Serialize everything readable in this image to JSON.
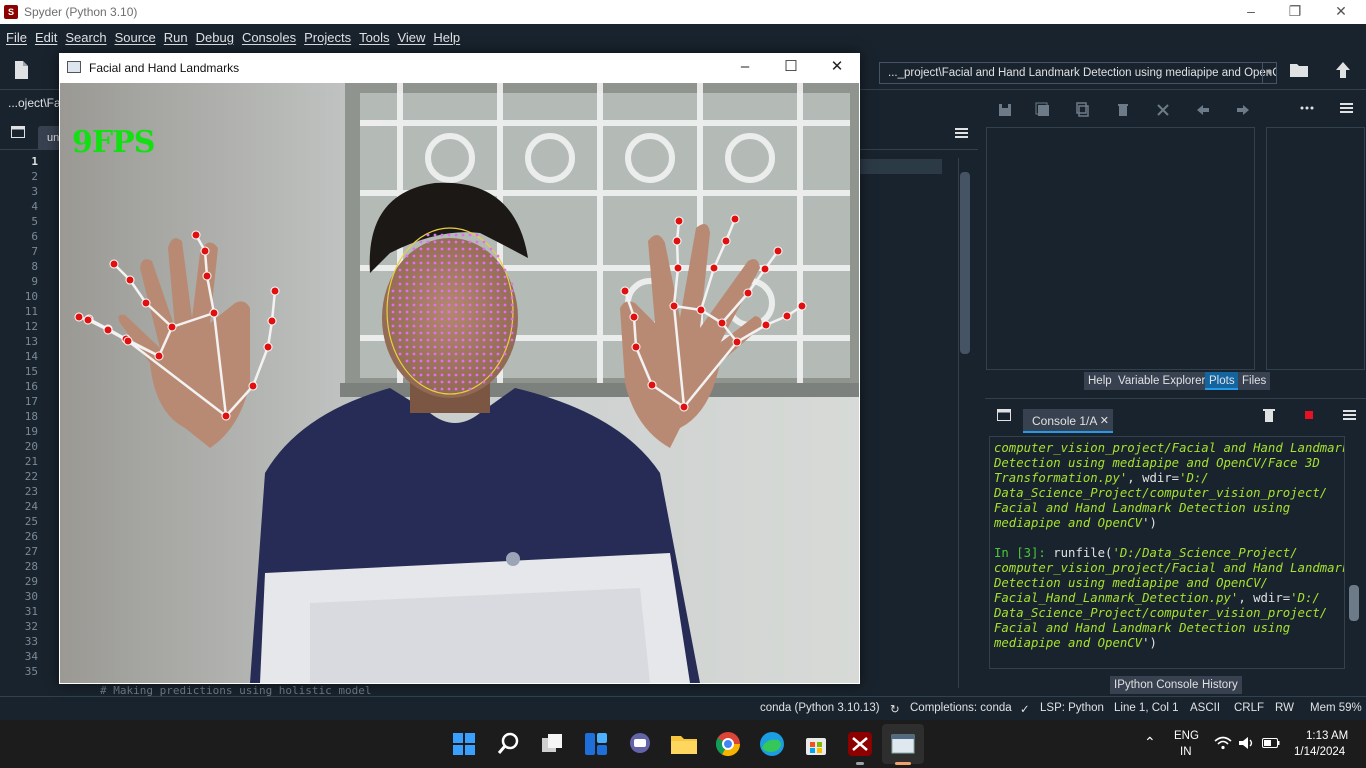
{
  "app": {
    "title": "Spyder (Python 3.10)",
    "icon_name": "spyder-icon",
    "window_controls": [
      "minimize-icon",
      "maximize-icon",
      "close-icon"
    ]
  },
  "menu": [
    "File",
    "Edit",
    "Search",
    "Source",
    "Run",
    "Debug",
    "Consoles",
    "Projects",
    "Tools",
    "View",
    "Help"
  ],
  "toolbar": {
    "path": "..._project\\Facial and Hand Landmark Detection using mediapipe and OpenCV",
    "icons": [
      "new-file-icon",
      "open-file-icon",
      "browse-folder-icon",
      "parent-directory-icon"
    ]
  },
  "editor": {
    "path_label": "...oject\\Fa",
    "tab_label": "un",
    "line_numbers": [
      "1",
      "2",
      "3",
      "4",
      "5",
      "6",
      "7",
      "8",
      "9",
      "10",
      "11",
      "12",
      "13",
      "14",
      "15",
      "16",
      "17",
      "18",
      "19",
      "20",
      "21",
      "22",
      "23",
      "24",
      "25",
      "26",
      "27",
      "28",
      "29",
      "30",
      "31",
      "32",
      "33",
      "34",
      "35"
    ],
    "current_line": "1",
    "visible_comment": "# Making predictions using holistic model"
  },
  "plots_pane": {
    "tabs": [
      "Help",
      "Variable Explorer",
      "Plots",
      "Files"
    ],
    "active_tab": "Plots"
  },
  "console": {
    "tab_label": "Console 1/A",
    "lines": [
      {
        "kind": "s",
        "text": "computer_vision_project/Facial and Hand Landmark"
      },
      {
        "kind": "s",
        "text": "Detection using mediapipe and OpenCV/Face 3D"
      },
      {
        "kind": "mix",
        "parts": [
          [
            "s",
            "Transformation.py'"
          ],
          [
            "n",
            ", wdir="
          ],
          [
            "s",
            "'D:/"
          ]
        ]
      },
      {
        "kind": "s",
        "text": "Data_Science_Project/computer_vision_project/"
      },
      {
        "kind": "s",
        "text": "Facial and Hand Landmark Detection using"
      },
      {
        "kind": "mix",
        "parts": [
          [
            "s",
            "mediapipe and OpenCV"
          ],
          [
            "n",
            "')"
          ]
        ]
      },
      {
        "kind": "blank",
        "text": ""
      },
      {
        "kind": "mix",
        "parts": [
          [
            "p",
            "In [3]: "
          ],
          [
            "n",
            "runfile("
          ],
          [
            "s",
            "'D:/Data_Science_Project/"
          ]
        ]
      },
      {
        "kind": "s",
        "text": "computer_vision_project/Facial and Hand Landmark"
      },
      {
        "kind": "s",
        "text": "Detection using mediapipe and OpenCV/"
      },
      {
        "kind": "mix",
        "parts": [
          [
            "s",
            "Facial_Hand_Lanmark_Detection.py'"
          ],
          [
            "n",
            ", wdir="
          ],
          [
            "s",
            "'D:/"
          ]
        ]
      },
      {
        "kind": "s",
        "text": "Data_Science_Project/computer_vision_project/"
      },
      {
        "kind": "s",
        "text": "Facial and Hand Landmark Detection using"
      },
      {
        "kind": "mix",
        "parts": [
          [
            "s",
            "mediapipe and OpenCV"
          ],
          [
            "n",
            "')"
          ]
        ]
      }
    ],
    "bottom_tabs": [
      "IPython Console",
      "History"
    ],
    "active_bottom_tab": "IPython Console"
  },
  "statusbar": {
    "env": "conda (Python 3.10.13)",
    "completions": "Completions: conda",
    "lsp": "LSP: Python",
    "position": "Line 1, Col 1",
    "encoding": "ASCII",
    "eol": "CRLF",
    "rw": "RW",
    "mem": "Mem 59%"
  },
  "cv_window": {
    "title": "Facial and Hand Landmarks",
    "fps_text": "9FPS",
    "fps_color": "#12e012",
    "landmark_color": "#e01010",
    "connection_color": "#f2f2f2",
    "face_mesh_color": "#e070f0"
  },
  "taskbar": {
    "apps": [
      "windows-start-icon",
      "search-icon",
      "task-view-icon",
      "widgets-icon",
      "teams-chat-icon",
      "file-explorer-icon",
      "chrome-icon",
      "edge-icon",
      "store-icon",
      "spyder-taskbar-icon",
      "opencv-window-taskbar-icon"
    ],
    "lang": "ENG",
    "region": "IN",
    "time": "1:13 AM",
    "date": "1/14/2024"
  },
  "colors": {
    "bg": "#19232d",
    "accent": "#1464a0",
    "border": "#32414b"
  }
}
